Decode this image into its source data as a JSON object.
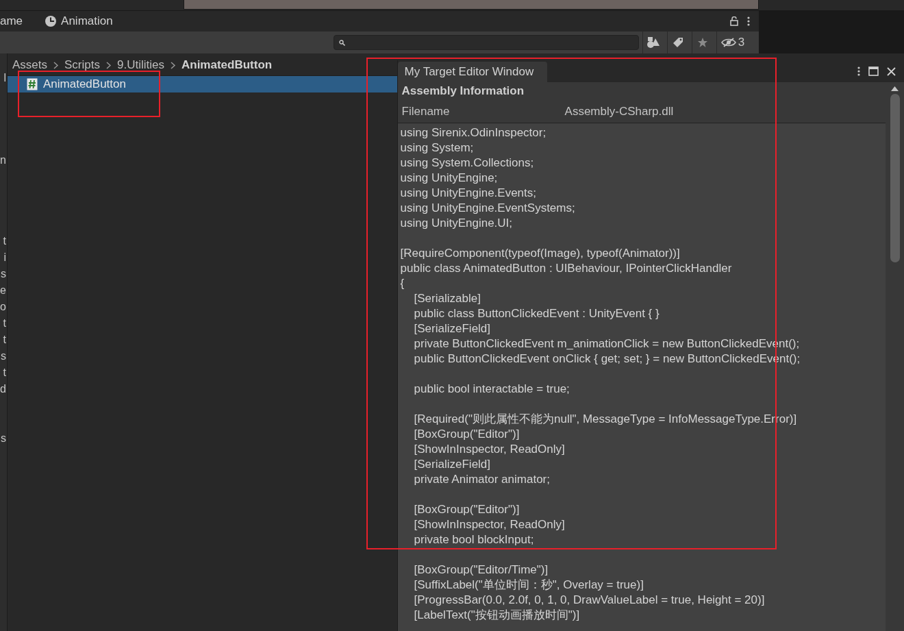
{
  "top_tabs": [
    {
      "label": "ame",
      "selected": false
    },
    {
      "label": "Animation",
      "selected": false
    }
  ],
  "left_fragments": [
    {
      "text": "l"
    },
    {
      "text": "n"
    },
    {
      "text": "t"
    },
    {
      "text": "i"
    },
    {
      "text": "s"
    },
    {
      "text": "e"
    },
    {
      "text": "o"
    },
    {
      "text": "t"
    },
    {
      "text": "t"
    },
    {
      "text": "s"
    },
    {
      "text": "t"
    },
    {
      "text": "d"
    },
    {
      "text": "s"
    }
  ],
  "toolbar": {
    "hidden_count": "3"
  },
  "breadcrumb": [
    "Assets",
    "Scripts",
    "9.Utilities",
    "AnimatedButton"
  ],
  "files": [
    {
      "name": "AnimatedButton",
      "selected": true,
      "highlighted": true
    }
  ],
  "editor_window": {
    "highlighted": true,
    "tab": "My Target Editor Window",
    "section_title": "Assembly Information",
    "field_label": "Filename",
    "field_value": "Assembly-CSharp.dll",
    "code_lines": [
      {
        "kind": "top",
        "text": "using Sirenix.OdinInspector;"
      },
      {
        "kind": "top",
        "text": "using System;"
      },
      {
        "kind": "top",
        "text": "using System.Collections;"
      },
      {
        "kind": "top",
        "text": "using UnityEngine;"
      },
      {
        "kind": "top",
        "text": "using UnityEngine.Events;"
      },
      {
        "kind": "top",
        "text": "using UnityEngine.EventSystems;"
      },
      {
        "kind": "top",
        "text": "using UnityEngine.UI;"
      },
      {
        "kind": "blank"
      },
      {
        "kind": "top",
        "text": "[RequireComponent(typeof(Image), typeof(Animator))]"
      },
      {
        "kind": "top",
        "text": "public class AnimatedButton : UIBehaviour, IPointerClickHandler"
      },
      {
        "kind": "top",
        "text": "{"
      },
      {
        "kind": "member",
        "text": "[Serializable]"
      },
      {
        "kind": "member",
        "text": "public class ButtonClickedEvent : UnityEvent { }"
      },
      {
        "kind": "member",
        "text": "[SerializeField]"
      },
      {
        "kind": "member",
        "text": "private ButtonClickedEvent m_animationClick = new ButtonClickedEvent();"
      },
      {
        "kind": "member",
        "text": "public ButtonClickedEvent onClick { get; set; } = new ButtonClickedEvent();"
      },
      {
        "kind": "blank"
      },
      {
        "kind": "member",
        "text": "public bool interactable = true;"
      },
      {
        "kind": "blank"
      },
      {
        "kind": "member",
        "text": "[Required(\"则此属性不能为null\", MessageType = InfoMessageType.Error)]"
      },
      {
        "kind": "member",
        "text": "[BoxGroup(\"Editor\")]"
      },
      {
        "kind": "member",
        "text": "[ShowInInspector, ReadOnly]"
      },
      {
        "kind": "member",
        "text": "[SerializeField]"
      },
      {
        "kind": "member",
        "text": "private Animator animator;"
      },
      {
        "kind": "blank"
      },
      {
        "kind": "member",
        "text": "[BoxGroup(\"Editor\")]"
      },
      {
        "kind": "member",
        "text": "[ShowInInspector, ReadOnly]"
      },
      {
        "kind": "member",
        "text": "private bool blockInput;"
      },
      {
        "kind": "blank"
      },
      {
        "kind": "member",
        "text": "[BoxGroup(\"Editor/Time\")]"
      },
      {
        "kind": "member",
        "text": "[SuffixLabel(\"单位时间：秒\", Overlay = true)]"
      },
      {
        "kind": "member",
        "text": "[ProgressBar(0.0, 2.0f, 0, 1, 0, DrawValueLabel = true, Height = 20)]"
      },
      {
        "kind": "member",
        "text": "[LabelText(\"按钮动画播放时间\")]"
      }
    ]
  }
}
